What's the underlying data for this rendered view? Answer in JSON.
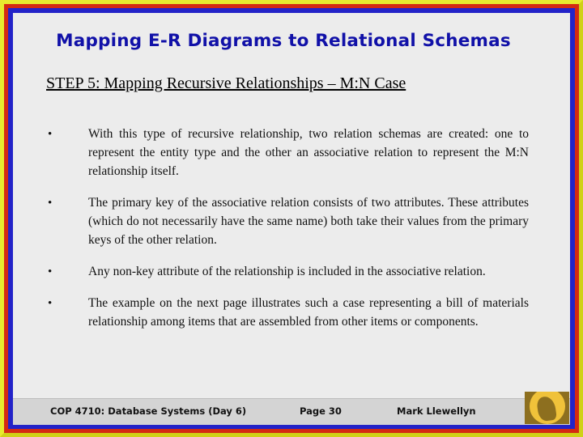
{
  "slide": {
    "title": "Mapping E-R Diagrams to Relational Schemas",
    "subtitle": "STEP 5:  Mapping Recursive Relationships – M:N Case",
    "bullet_marker": "•",
    "bullets": [
      "With this type of recursive relationship, two relation schemas are created: one to represent the entity type and the other an associative relation to represent the M:N relationship itself.",
      "The primary key of the associative relation consists of two attributes. These attributes (which do not necessarily have the same name) both take their values from the primary keys of the other relation.",
      "Any non-key attribute of the relationship is included in the associative relation.",
      "The example on the next page illustrates such a case representing a bill of materials relationship among items that are assembled from other items or components."
    ],
    "footer": {
      "course": "COP 4710: Database Systems  (Day 6)",
      "page": "Page 30",
      "author": "Mark Llewellyn"
    },
    "colors": {
      "title": "#1111A8",
      "border_yellow": "#D8DA20",
      "border_red": "#D42A12",
      "border_blue": "#2323C8",
      "background": "#ECECEC",
      "footer_bar": "#D4D4D4",
      "logo_gold": "#F0C23A"
    }
  }
}
